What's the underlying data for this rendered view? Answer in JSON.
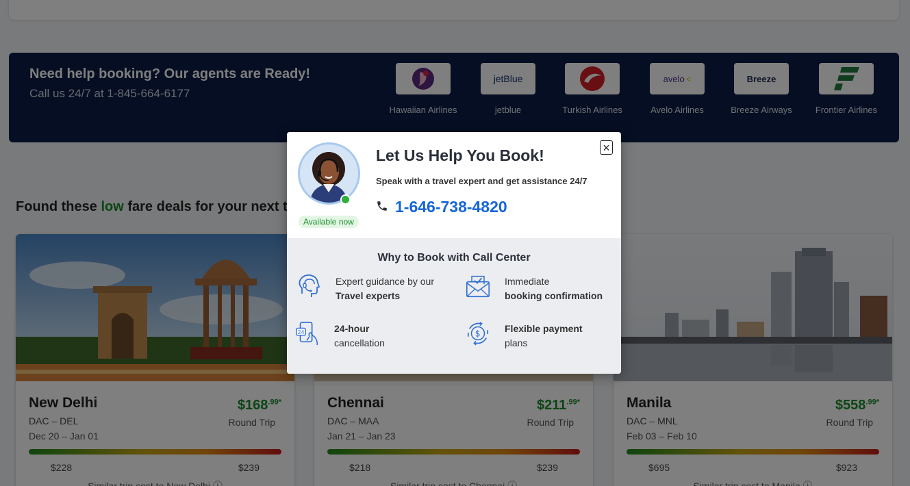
{
  "banner": {
    "title": "Need help booking? Our agents are Ready!",
    "subtitle": "Call us 24/7 at 1-845-664-6177",
    "airlines": [
      {
        "name": "Hawaiian Airlines",
        "logo_text": ""
      },
      {
        "name": "jetblue",
        "logo_text": "jetBlue"
      },
      {
        "name": "Turkish Airlines",
        "logo_text": ""
      },
      {
        "name": "Avelo Airlines",
        "logo_text": "avelo"
      },
      {
        "name": "Breeze Airways",
        "logo_text": "Breeze"
      },
      {
        "name": "Frontier Airlines",
        "logo_text": ""
      }
    ]
  },
  "deals": {
    "title_prefix": "Found these ",
    "title_highlight": "low",
    "title_suffix": " fare deals for your next trip",
    "cards": [
      {
        "city": "New Delhi",
        "route": "DAC – DEL",
        "dates": "Dec 20 – Jan 01",
        "price_main": "$168",
        "price_cents": ".99",
        "price_star": "*",
        "trip_type": "Round Trip",
        "low": "$228",
        "high": "$239",
        "similar": "Similar trip cost to New Delhi"
      },
      {
        "city": "Chennai",
        "route": "DAC – MAA",
        "dates": "Jan 21 – Jan 23",
        "price_main": "$211",
        "price_cents": ".99",
        "price_star": "*",
        "trip_type": "Round Trip",
        "low": "$218",
        "high": "$239",
        "similar": "Similar trip cost to Chennai"
      },
      {
        "city": "Manila",
        "route": "DAC – MNL",
        "dates": "Feb 03 – Feb 10",
        "price_main": "$558",
        "price_cents": ".99",
        "price_star": "*",
        "trip_type": "Round Trip",
        "low": "$695",
        "high": "$923",
        "similar": "Similar trip cost to Manila"
      }
    ]
  },
  "modal": {
    "title": "Let Us Help You Book!",
    "subtitle": "Speak with a travel expert and get assistance 24/7",
    "phone": "1-646-738-4820",
    "availability": "Available now",
    "close_symbol": "×",
    "why_title": "Why to Book with Call Center",
    "features": [
      {
        "icon": "headset-agent-icon",
        "line1": "Expert guidance by our",
        "line2": "Travel experts",
        "bold_line": 2
      },
      {
        "icon": "envelope-check-icon",
        "line1": "Immediate",
        "line2": "booking confirmation",
        "bold_line": 2
      },
      {
        "icon": "phone-24-icon",
        "line1": "24-hour",
        "line2": "cancellation",
        "bold_line": 1
      },
      {
        "icon": "dollar-cycle-icon",
        "line1": "Flexible payment",
        "line2": "plans",
        "bold_line": 1
      }
    ]
  },
  "colors": {
    "banner_bg": "#0b1d44",
    "price_green": "#1a8a2b",
    "phone_blue": "#1565d8",
    "icon_blue": "#2f6fd1"
  }
}
